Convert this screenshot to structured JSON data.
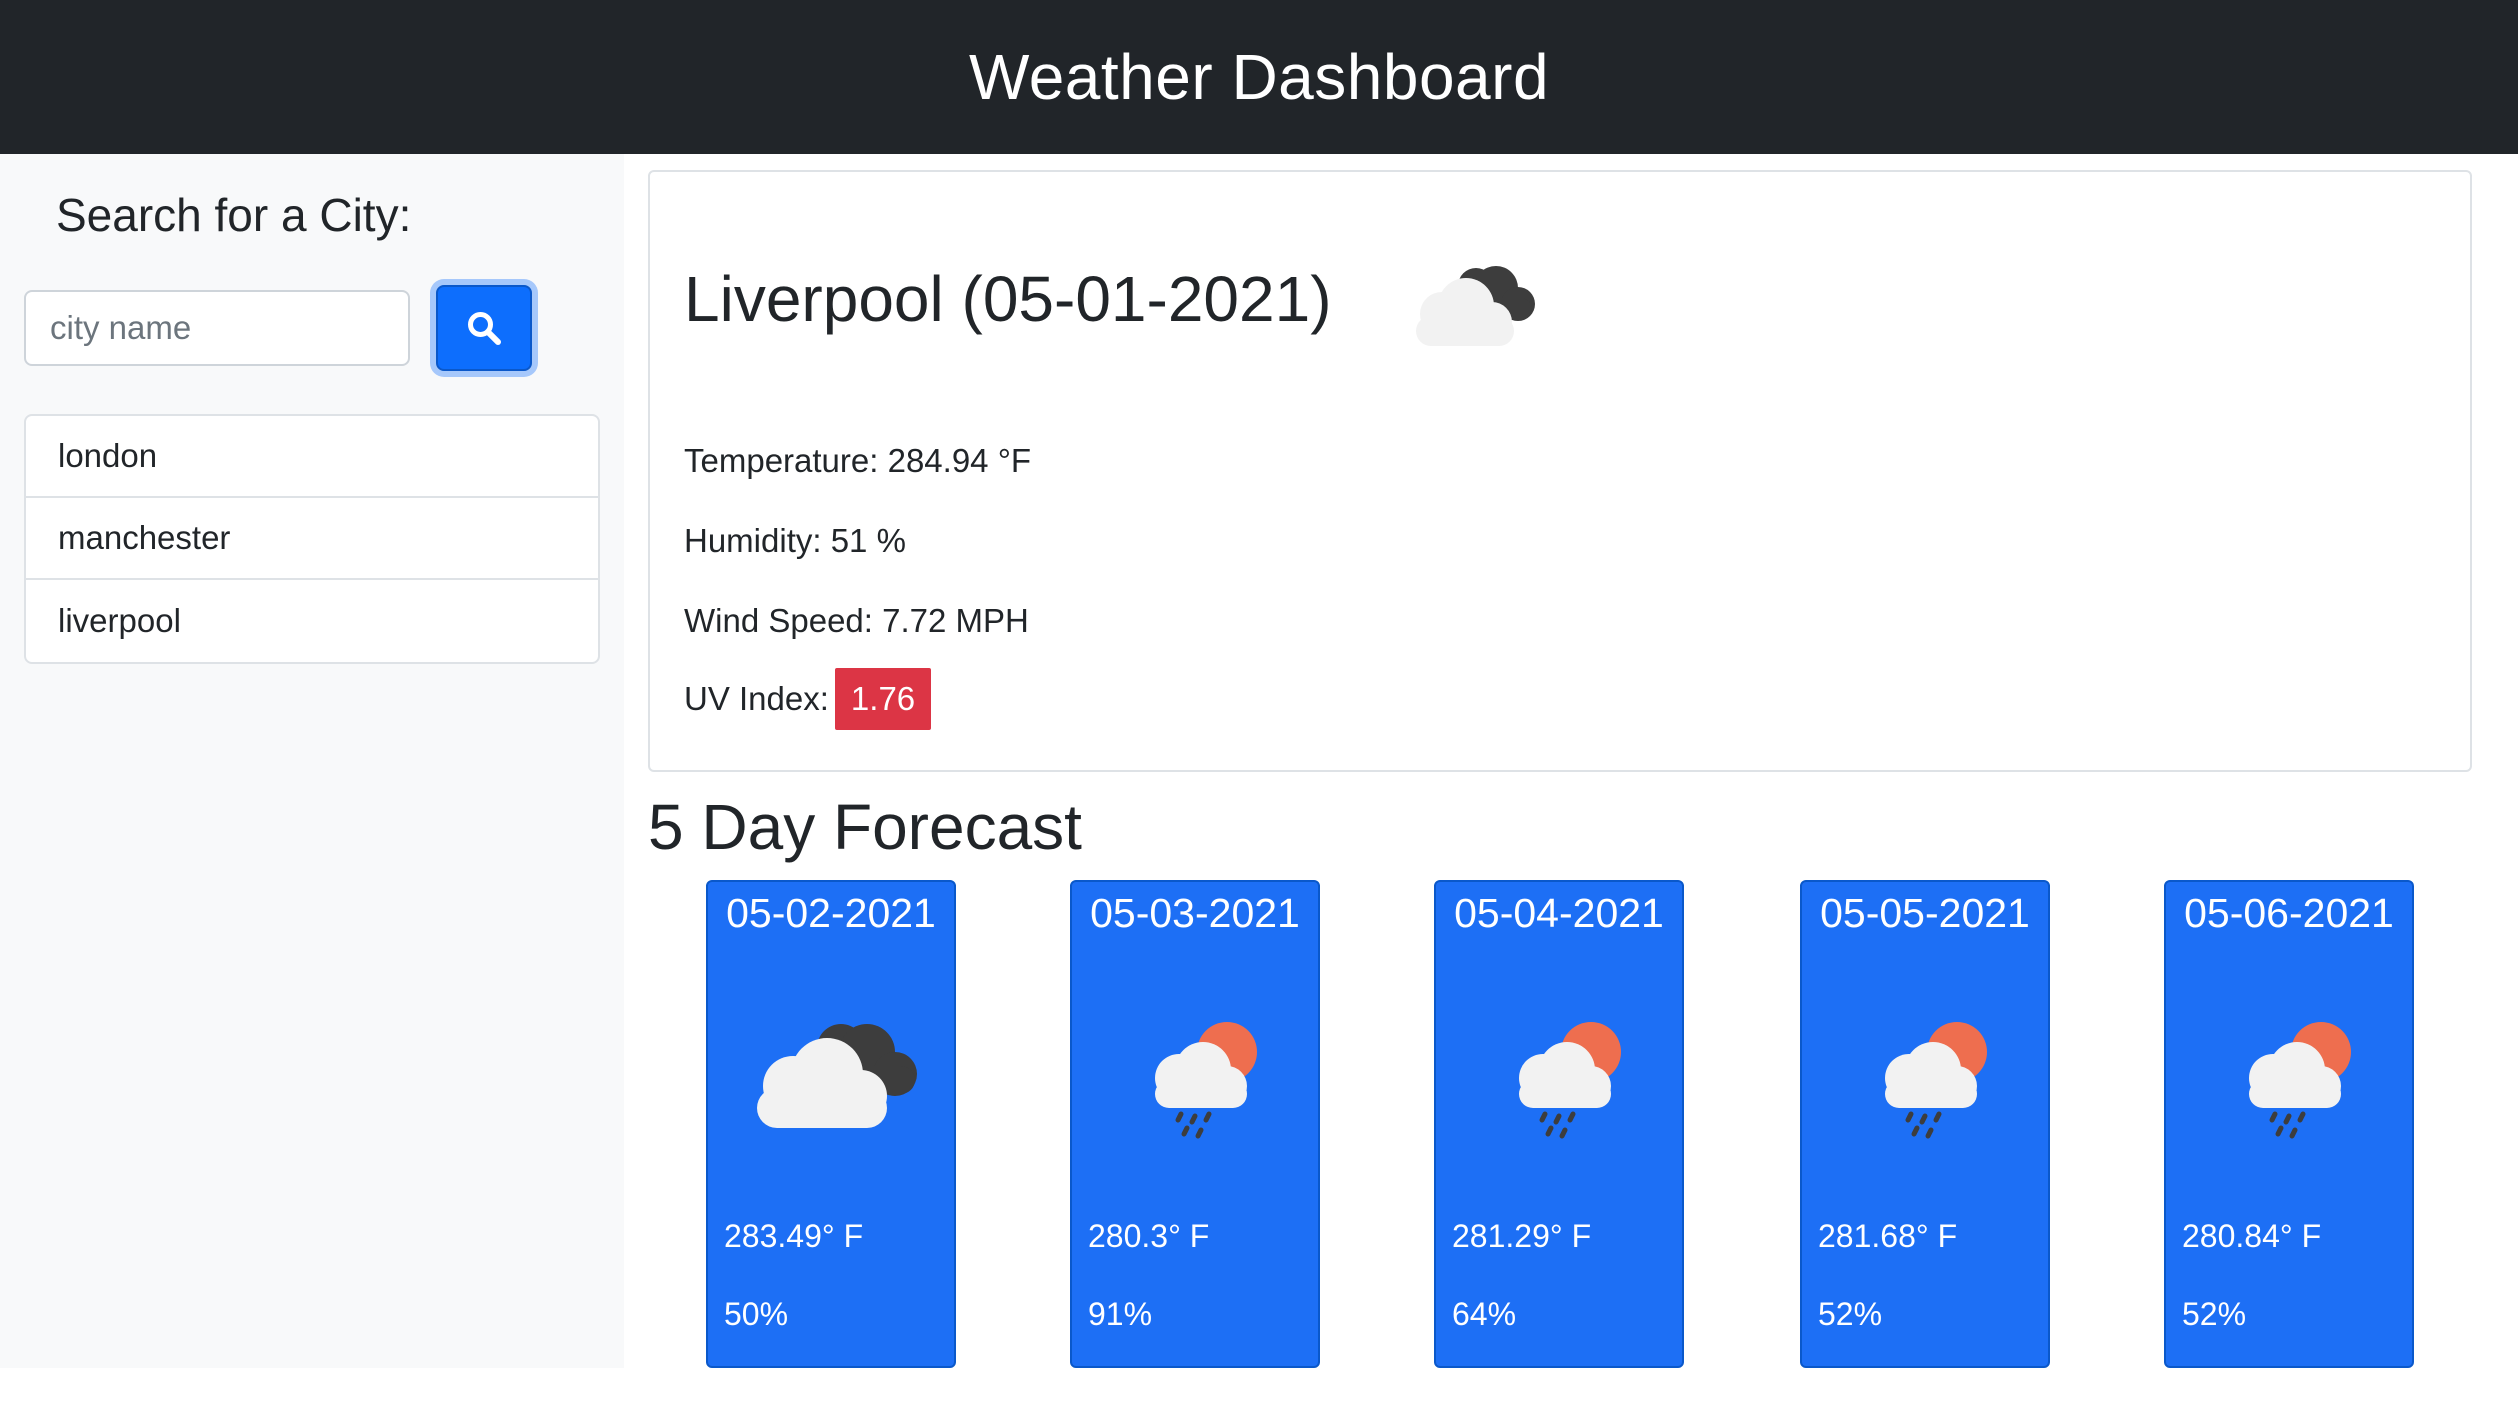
{
  "header": {
    "title": "Weather Dashboard"
  },
  "sidebar": {
    "search_title": "Search for a City:",
    "search_placeholder": "city name",
    "search_button_icon": "search-icon",
    "cities": [
      "london",
      "manchester",
      "liverpool"
    ]
  },
  "current": {
    "title": "Liverpool (05-01-2021)",
    "icon": "broken-clouds-icon",
    "temperature": "Temperature: 284.94 °F",
    "humidity": "Humidity: 51 %",
    "wind": "Wind Speed: 7.72 MPH",
    "uv_label": "UV Index:",
    "uv_value": "1.76",
    "uv_color": "#dc3545"
  },
  "forecast": {
    "title": "5 Day Forecast",
    "card_color": "#1d6ff5",
    "days": [
      {
        "date": "05-02-2021",
        "icon": "broken-clouds-icon",
        "temp": "283.49° F",
        "humidity": "50%"
      },
      {
        "date": "05-03-2021",
        "icon": "rain-sun-icon",
        "temp": "280.3° F",
        "humidity": "91%"
      },
      {
        "date": "05-04-2021",
        "icon": "rain-sun-icon",
        "temp": "281.29° F",
        "humidity": "64%"
      },
      {
        "date": "05-05-2021",
        "icon": "rain-sun-icon",
        "temp": "281.68° F",
        "humidity": "52%"
      },
      {
        "date": "05-06-2021",
        "icon": "rain-sun-icon",
        "temp": "280.84° F",
        "humidity": "52%"
      }
    ]
  }
}
